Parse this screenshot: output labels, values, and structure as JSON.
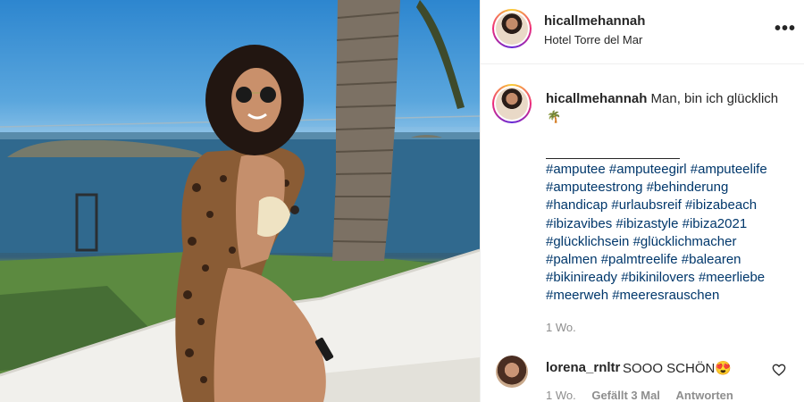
{
  "post": {
    "username": "hicallmehannah",
    "location": "Hotel Torre del Mar",
    "more_icon": "more-horizontal-icon",
    "caption_text": "Man, bin ich glücklich",
    "caption_emoji": "🌴",
    "hashtag_lines": [
      [
        "#amputee",
        "#amputeegirl",
        "#amputeelife"
      ],
      [
        "#amputeestrong",
        "#behinderung"
      ],
      [
        "#handicap",
        "#urlaubsreif",
        "#ibizabeach"
      ],
      [
        "#ibizavibes",
        "#ibizastyle",
        "#ibiza2021"
      ],
      [
        "#glücklichsein",
        "#glücklichmacher"
      ],
      [
        "#palmen",
        "#palmtreelife",
        "#balearen"
      ],
      [
        "#bikiniready",
        "#bikinilovers",
        "#meerliebe"
      ],
      [
        "#meerweh",
        "#meeresrauschen"
      ]
    ],
    "age": "1 Wo."
  },
  "comment": {
    "username": "lorena_rnltr",
    "text": "SOOO SCHÖN😍",
    "age": "1 Wo.",
    "likes": "Gefällt 3 Mal",
    "reply": "Antworten",
    "like_icon": "heart-outline-icon"
  },
  "colors": {
    "hashtag": "#00376b",
    "meta": "#8e8e8e",
    "text": "#262626"
  }
}
